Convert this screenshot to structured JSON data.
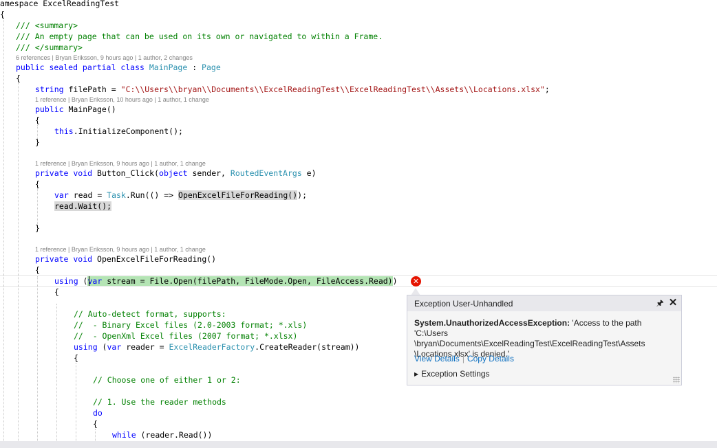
{
  "code": {
    "namespace_line": "amespace ExcelReadingTest",
    "brace_ns_open": "{",
    "summary_1": "/// <summary>",
    "summary_2": "/// An empty page that can be used on its own or navigated to within a Frame.",
    "summary_3": "/// </summary>",
    "lens_class": "6 references | Bryan Eriksson, 9 hours ago | 1 author, 2 changes",
    "class_kw": "public sealed partial class ",
    "class_name": "MainPage",
    "class_colon": " : ",
    "class_base": "Page",
    "brace_class_open": "{",
    "field_type": "string",
    "field_name": " filePath = ",
    "field_value": "\"C:\\\\Users\\\\bryan\\\\Documents\\\\ExcelReadingTest\\\\ExcelReadingTest\\\\Assets\\\\Locations.xlsx\"",
    "field_end": ";",
    "lens_ctor": "1 reference | Bryan Eriksson, 10 hours ago | 1 author, 1 change",
    "ctor_kw": "public",
    "ctor_name": " MainPage()",
    "brace_ctor_open": "{",
    "ctor_this": "this",
    "ctor_call": ".InitializeComponent();",
    "brace_ctor_close": "}",
    "lens_click": "1 reference | Bryan Eriksson, 9 hours ago | 1 author, 1 change",
    "click_kw": "private void",
    "click_name": " Button_Click(",
    "click_object": "object",
    "click_sender": " sender, ",
    "click_args_type": "RoutedEventArgs",
    "click_args": " e)",
    "brace_click_open": "{",
    "read_var": "var",
    "read_mid": " read = ",
    "read_task": "Task",
    "read_run": ".Run(() => ",
    "read_hl": "OpenExcelFileForReading()",
    "read_end": ");",
    "wait_hl": "read.Wait();",
    "brace_click_close": "}",
    "lens_open": "1 reference | Bryan Eriksson, 9 hours ago | 1 author, 1 change",
    "open_kw": "private void",
    "open_name": " OpenExcelFileForReading()",
    "brace_open_open": "{",
    "using_kw": "using",
    "using_paren": " (",
    "using_var": "var",
    "using_rest": " stream = File.Open(filePath, FileMode.Open, FileAccess.Read)",
    "using_close": ")",
    "brace_using_open": "{",
    "comment_1": "// Auto-detect format, supports:",
    "comment_2": "//  - Binary Excel files (2.0-2003 format; *.xls)",
    "comment_3": "//  - OpenXml Excel files (2007 format; *.xlsx)",
    "using2_kw": "using",
    "using2_mid": " (",
    "using2_var": "var",
    "using2_reader": " reader = ",
    "using2_factory": "ExcelReaderFactory",
    "using2_end": ".CreateReader(stream))",
    "brace_reader_open": "{",
    "comment_4": "// Choose one of either 1 or 2:",
    "comment_5": "// 1. Use the reader methods",
    "do_kw": "do",
    "brace_do_open": "{",
    "while_kw": "while",
    "while_rest": " (reader.Read())"
  },
  "exception_popup": {
    "title": "Exception User-Unhandled",
    "pin_icon": "🖈",
    "close_icon": "✕",
    "exception_type": "System.UnauthorizedAccessException:",
    "message_1": " 'Access to the path 'C:\\Users",
    "message_2": "\\bryan\\Documents\\ExcelReadingTest\\ExcelReadingTest\\Assets",
    "message_3": "\\Locations.xlsx' is denied.'",
    "view_details": "View Details",
    "separator": "|",
    "copy_details": "Copy Details",
    "expand_icon": "▶",
    "exception_settings": "Exception Settings"
  },
  "error_icon": "✕",
  "colors": {
    "keyword": "#0000ff",
    "type": "#2b91af",
    "string": "#a31515",
    "comment": "#008000",
    "error": "#e51400",
    "link": "#0e70c0"
  }
}
